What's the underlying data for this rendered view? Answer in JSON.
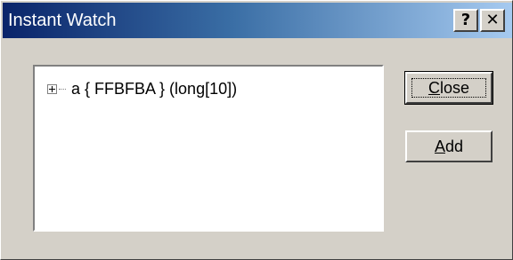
{
  "window": {
    "title": "Instant Watch",
    "help_glyph": "?",
    "close_glyph": "✕"
  },
  "watch_tree": {
    "items": [
      {
        "expander": "+",
        "text": "a  { FFBFBA } (long[10])"
      }
    ]
  },
  "buttons": {
    "close": {
      "mnemonic": "C",
      "rest": "lose"
    },
    "add": {
      "mnemonic": "A",
      "rest": "dd"
    }
  },
  "colors": {
    "face": "#d4d0c8",
    "title_start": "#0a246a",
    "title_end": "#a6caf0"
  }
}
